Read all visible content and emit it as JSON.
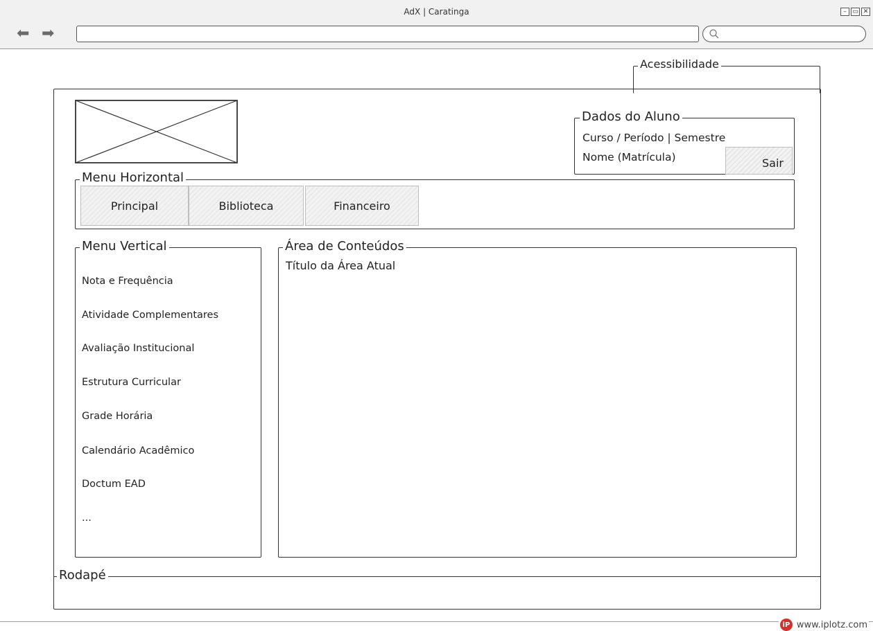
{
  "browser": {
    "window_title": "AdX | Caratinga",
    "back_glyph": "⬅",
    "forward_glyph": "➡",
    "address_value": "",
    "search_value": ""
  },
  "top": {
    "accessibility_label": "Acessibilidade"
  },
  "header": {
    "student": {
      "legend": "Dados do Aluno",
      "course_line": "Curso / Período | Semestre",
      "name_line": "Nome (Matrícula)",
      "logout_label": "Sair"
    }
  },
  "horizontal_menu": {
    "legend": "Menu Horizontal",
    "tabs": [
      {
        "label": "Principal"
      },
      {
        "label": "Biblioteca"
      },
      {
        "label": "Financeiro"
      }
    ]
  },
  "vertical_menu": {
    "legend": "Menu Vertical",
    "items": [
      {
        "label": "Nota e Frequência"
      },
      {
        "label": "Atividade Complementares"
      },
      {
        "label": "Avaliação Institucional"
      },
      {
        "label": "Estrutura Curricular"
      },
      {
        "label": "Grade Horária"
      },
      {
        "label": "Calendário Acadêmico"
      },
      {
        "label": "Doctum EAD"
      },
      {
        "label": "..."
      }
    ]
  },
  "content": {
    "legend": "Área de Conteúdos",
    "area_title": "Título da Área Atual"
  },
  "footer": {
    "legend": "Rodapé"
  },
  "watermark": {
    "text": "www.iplotz.com"
  }
}
